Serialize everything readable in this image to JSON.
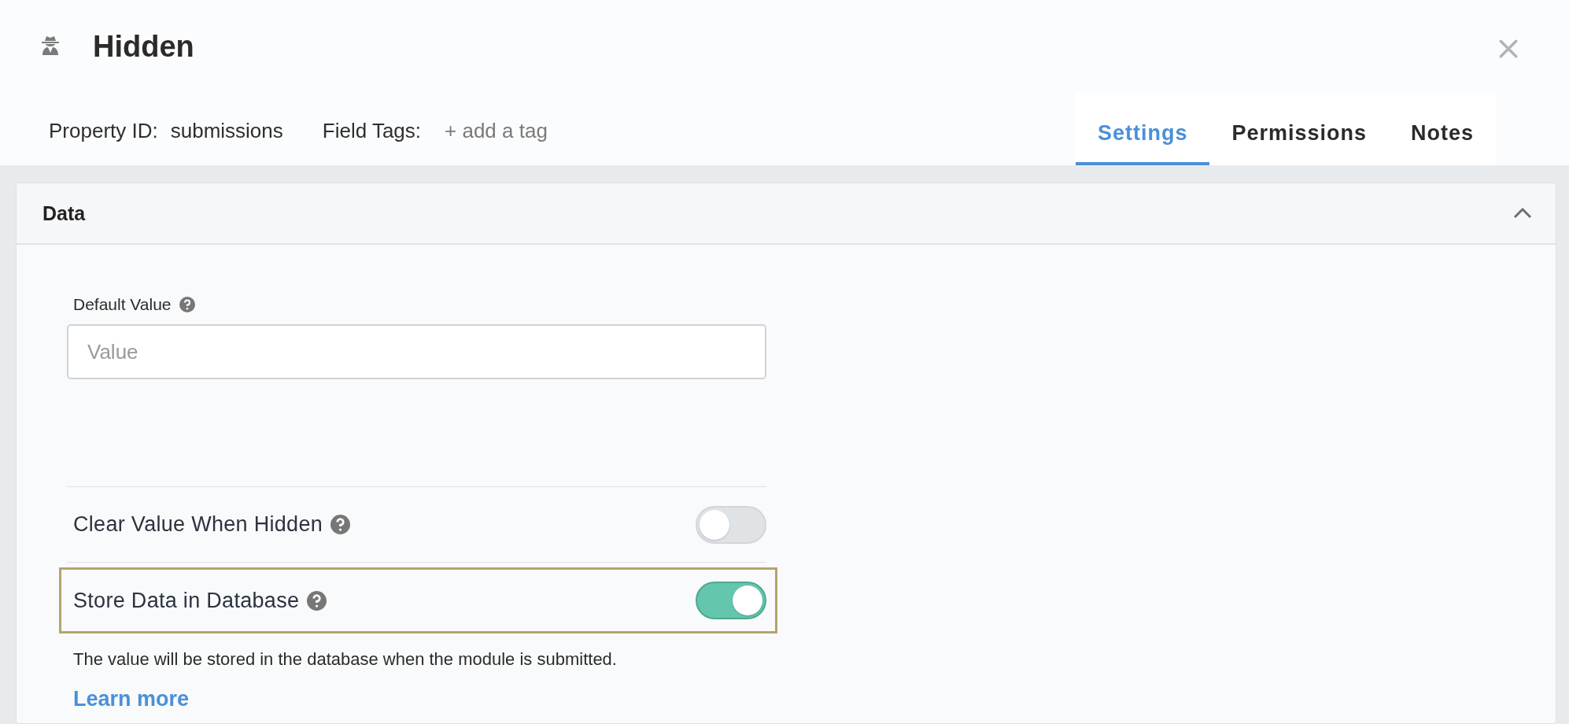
{
  "window": {
    "title": "Hidden"
  },
  "property_id": {
    "label": "Property ID:",
    "value": "submissions"
  },
  "field_tags": {
    "label": "Field Tags:",
    "action": "+ add a tag"
  },
  "tabs": [
    {
      "label": "Settings",
      "selected": true
    },
    {
      "label": "Permissions",
      "selected": false
    },
    {
      "label": "Notes",
      "selected": false
    }
  ],
  "section": {
    "title": "Data",
    "expanded": true,
    "default_value": {
      "label": "Default Value",
      "placeholder": "Value"
    },
    "toggles": [
      {
        "label": "Clear Value When Hidden",
        "on": false,
        "highlighted": false
      },
      {
        "label": "Store Data in Database",
        "on": true,
        "highlighted": true
      }
    ],
    "description": "The value will be stored in the database when the module is submitted.",
    "link": "Learn more"
  }
}
